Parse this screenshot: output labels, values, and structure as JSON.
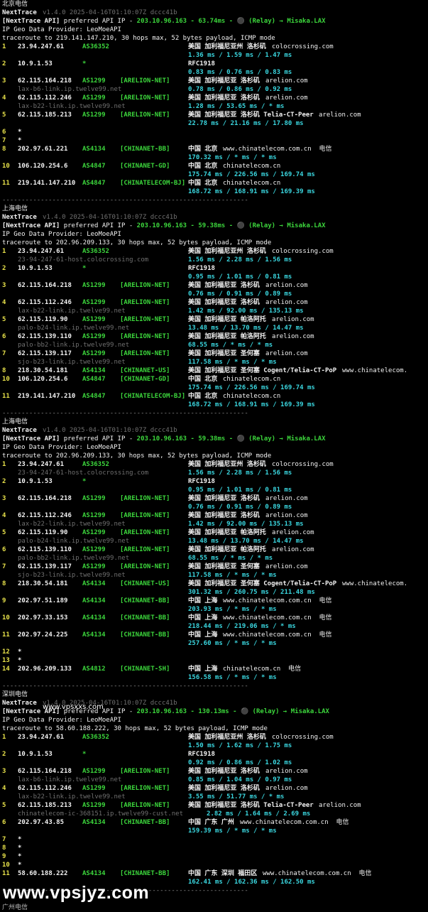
{
  "blocks": [
    {
      "title": "北京电信",
      "app": "NextTrace",
      "version": "v1.4.0 2025-04-16T01:10:07Z dccc41b",
      "api_line": "[NextTrace API] preferred API IP - 203.10.96.163 - 63.74ms - ⚫ (Relay) → Misaka.LAX",
      "geo": "IP Geo Data Provider: LeoMoeAPI",
      "trace": "traceroute to 219.141.147.210, 30 hops max, 52 bytes payload, ICMP mode",
      "hops": [
        {
          "n": "1",
          "ip": "23.94.247.61",
          "as": "AS36352",
          "tag": "",
          "geo": "美国 加利福尼亚州 洛杉矶",
          "host": "colocrossing.com",
          "rdns": "",
          "rtt": "1.36 ms / 1.59 ms / 1.47 ms"
        },
        {
          "n": "2",
          "ip": "10.9.1.53",
          "as": "*",
          "tag": "",
          "geo": "RFC1918",
          "host": "",
          "rdns": "",
          "rtt": "0.83 ms / 0.76 ms / 0.83 ms"
        },
        {
          "n": "3",
          "ip": "62.115.164.218",
          "as": "AS1299",
          "tag": "[ARELION-NET]",
          "geo": "美国 加利福尼亚 洛杉矶",
          "host": "arelion.com",
          "rdns": "lax-b6-link.ip.twelve99.net",
          "rtt": "0.78 ms / 0.86 ms / 0.92 ms"
        },
        {
          "n": "4",
          "ip": "62.115.112.246",
          "as": "AS1299",
          "tag": "[ARELION-NET]",
          "geo": "美国 加利福尼亚 洛杉矶",
          "host": "arelion.com",
          "rdns": "lax-b22-link.ip.twelve99.net",
          "rtt": "1.28 ms / 53.65 ms / * ms"
        },
        {
          "n": "5",
          "ip": "62.115.185.213",
          "as": "AS1299",
          "tag": "[ARELION-NET]",
          "geo": "美国 加利福尼亚 洛杉矶 Telia-CT-Peer",
          "host": "arelion.com",
          "rdns": "",
          "rtt": "22.78 ms / 21.16 ms / 17.80 ms"
        },
        {
          "n": "6",
          "star": true
        },
        {
          "n": "7",
          "star": true
        },
        {
          "n": "8",
          "ip": "202.97.61.221",
          "as": "AS4134",
          "tag": "[CHINANET-BB]",
          "geo": "中国 北京",
          "host": "www.chinatelecom.com.cn  电信",
          "rdns": "",
          "rtt": "170.32 ms / * ms / * ms"
        },
        {
          "n": "10",
          "ip": "106.120.254.6",
          "as": "AS4847",
          "tag": "[CHINANET-GD]",
          "geo": "中国 北京",
          "host": "chinatelecom.cn",
          "rdns": "",
          "rtt": "175.74 ms / 226.56 ms / 169.74 ms"
        },
        {
          "n": "11",
          "ip": "219.141.147.210",
          "as": "AS4847",
          "tag": "[CHINATELECOM-BJ]",
          "geo": "中国 北京",
          "host": "chinatelecom.cn",
          "rdns": "",
          "rtt": "168.72 ms / 168.91 ms / 169.39 ms"
        }
      ]
    },
    {
      "title": "上海电信",
      "app": "NextTrace",
      "version": "v1.4.0 2025-04-16T01:10:07Z dccc41b",
      "api_line": "[NextTrace API] preferred API IP - 203.10.96.163 - 59.38ms - ⚫ (Relay) → Misaka.LAX",
      "geo": "IP Geo Data Provider: LeoMoeAPI",
      "trace": "traceroute to 202.96.209.133, 30 hops max, 52 bytes payload, ICMP mode",
      "hops": [
        {
          "n": "1",
          "ip": "23.94.247.61",
          "as": "AS36352",
          "tag": "",
          "geo": "美国 加利福尼亚州 洛杉矶",
          "host": "colocrossing.com",
          "rdns": "23-94-247-61-host.colocrossing.com",
          "rtt": "1.56 ms / 2.28 ms / 1.56 ms"
        },
        {
          "n": "2",
          "ip": "10.9.1.53",
          "as": "*",
          "tag": "",
          "geo": "RFC1918",
          "host": "",
          "rdns": "",
          "rtt": "0.95 ms / 1.01 ms / 0.81 ms"
        },
        {
          "n": "3",
          "ip": "62.115.164.218",
          "as": "AS1299",
          "tag": "[ARELION-NET]",
          "geo": "美国 加利福尼亚 洛杉矶",
          "host": "arelion.com",
          "rdns": "",
          "rtt": "0.76 ms / 0.91 ms / 0.89 ms"
        },
        {
          "n": "4",
          "ip": "62.115.112.246",
          "as": "AS1299",
          "tag": "[ARELION-NET]",
          "geo": "美国 加利福尼亚 洛杉矶",
          "host": "arelion.com",
          "rdns": "lax-b22-link.ip.twelve99.net",
          "rtt": "1.42 ms / 92.00 ms / 135.13 ms"
        },
        {
          "n": "5",
          "ip": "62.115.119.90",
          "as": "AS1299",
          "tag": "[ARELION-NET]",
          "geo": "美国 加利福尼亚 帕洛阿托",
          "host": "arelion.com",
          "rdns": "palo-b24-link.ip.twelve99.net",
          "rtt": "13.48 ms / 13.70 ms / 14.47 ms"
        },
        {
          "n": "6",
          "ip": "62.115.139.110",
          "as": "AS1299",
          "tag": "[ARELION-NET]",
          "geo": "美国 加利福尼亚 帕洛阿托",
          "host": "arelion.com",
          "rdns": "palo-bb2-link.ip.twelve99.net",
          "rtt": "68.55 ms / * ms / * ms"
        },
        {
          "n": "7",
          "ip": "62.115.139.117",
          "as": "AS1299",
          "tag": "[ARELION-NET]",
          "geo": "美国 加利福尼亚 圣何塞",
          "host": "arelion.com",
          "rdns": "sjo-b23-link.ip.twelve99.net",
          "rtt": "117.58 ms / * ms / * ms"
        },
        {
          "n": "8",
          "ip": "218.30.54.181",
          "as": "AS4134",
          "tag": "[CHINANET-US]",
          "geo": "美国 加利福尼亚 圣何塞 Cogent/Telia-CT-PoP",
          "host": "www.chinatelecom.",
          "rdns": "",
          "rtt": ""
        },
        {
          "n": "10",
          "ip": "106.120.254.6",
          "as": "AS4847",
          "tag": "[CHINANET-GD]",
          "geo": "中国 北京",
          "host": "chinatelecom.cn",
          "rdns": "",
          "rtt": "175.74 ms / 226.56 ms / 169.74 ms",
          "garbled": true
        },
        {
          "n": "11",
          "ip": "219.141.147.210",
          "as": "AS4847",
          "tag": "[CHINATELECOM-BJ]",
          "geo": "中国 北京",
          "host": "chinatelecom.cn",
          "rdns": "",
          "rtt": "168.72 ms / 168.91 ms / 169.39 ms"
        }
      ]
    },
    {
      "title": "上海电信",
      "app": "NextTrace",
      "version": "v1.4.0 2025-04-16T01:10:07Z dccc41b",
      "api_line": "[NextTrace API] preferred API IP - 203.10.96.163 - 59.38ms - ⚫ (Relay) → Misaka.LAX",
      "geo": "IP Geo Data Provider: LeoMoeAPI",
      "trace": "traceroute to 202.96.209.133, 30 hops max, 52 bytes payload, ICMP mode",
      "hops": [
        {
          "n": "1",
          "ip": "23.94.247.61",
          "as": "AS36352",
          "tag": "",
          "geo": "美国 加利福尼亚州 洛杉矶",
          "host": "colocrossing.com",
          "rdns": "23-94-247-61-host.colocrossing.com",
          "rtt": "1.56 ms / 2.28 ms / 1.56 ms"
        },
        {
          "n": "2",
          "ip": "10.9.1.53",
          "as": "*",
          "tag": "",
          "geo": "RFC1918",
          "host": "",
          "rdns": "",
          "rtt": "0.95 ms / 1.01 ms / 0.81 ms"
        },
        {
          "n": "3",
          "ip": "62.115.164.218",
          "as": "AS1299",
          "tag": "[ARELION-NET]",
          "geo": "美国 加利福尼亚 洛杉矶",
          "host": "arelion.com",
          "rdns": "",
          "rtt": "0.76 ms / 0.91 ms / 0.89 ms"
        },
        {
          "n": "4",
          "ip": "62.115.112.246",
          "as": "AS1299",
          "tag": "[ARELION-NET]",
          "geo": "美国 加利福尼亚 洛杉矶",
          "host": "arelion.com",
          "rdns": "lax-b22-link.ip.twelve99.net",
          "rtt": "1.42 ms / 92.00 ms / 135.13 ms"
        },
        {
          "n": "5",
          "ip": "62.115.119.90",
          "as": "AS1299",
          "tag": "[ARELION-NET]",
          "geo": "美国 加利福尼亚 帕洛阿托",
          "host": "arelion.com",
          "rdns": "palo-b24-link.ip.twelve99.net",
          "rtt": "13.48 ms / 13.70 ms / 14.47 ms"
        },
        {
          "n": "6",
          "ip": "62.115.139.110",
          "as": "AS1299",
          "tag": "[ARELION-NET]",
          "geo": "美国 加利福尼亚 帕洛阿托",
          "host": "arelion.com",
          "rdns": "palo-bb2-link.ip.twelve99.net",
          "rtt": "68.55 ms / * ms / * ms"
        },
        {
          "n": "7",
          "ip": "62.115.139.117",
          "as": "AS1299",
          "tag": "[ARELION-NET]",
          "geo": "美国 加利福尼亚 圣何塞",
          "host": "arelion.com",
          "rdns": "sjo-b23-link.ip.twelve99.net",
          "rtt": "117.58 ms / * ms / * ms"
        },
        {
          "n": "8",
          "ip": "218.30.54.181",
          "as": "AS4134",
          "tag": "[CHINANET-US]",
          "geo": "美国 加利福尼亚 圣何塞 Cogent/Telia-CT-PoP",
          "host": "www.chinatelecom.",
          "rdns": "",
          "rtt": "301.32 ms / 260.75 ms / 211.48 ms"
        },
        {
          "n": "9",
          "ip": "202.97.51.189",
          "as": "AS4134",
          "tag": "[CHINANET-BB]",
          "geo": "中国 上海",
          "host": "www.chinatelecom.com.cn  电信",
          "rdns": "",
          "rtt": "203.93 ms / * ms / * ms"
        },
        {
          "n": "10",
          "ip": "202.97.33.153",
          "as": "AS4134",
          "tag": "[CHINANET-BB]",
          "geo": "中国 上海",
          "host": "www.chinatelecom.com.cn  电信",
          "rdns": "",
          "rtt": "218.44 ms / 219.06 ms / * ms"
        },
        {
          "n": "11",
          "ip": "202.97.24.225",
          "as": "AS4134",
          "tag": "[CHINANET-BB]",
          "geo": "中国 上海",
          "host": "www.chinatelecom.com.cn  电信",
          "rdns": "",
          "rtt": "257.60 ms / * ms / * ms"
        },
        {
          "n": "12",
          "star": true
        },
        {
          "n": "13",
          "star": true
        },
        {
          "n": "14",
          "ip": "202.96.209.133",
          "as": "AS4812",
          "tag": "[CHINANET-SH]",
          "geo": "中国 上海",
          "host": "chinatelecom.cn  电信",
          "rdns": "",
          "rtt": "156.58 ms / * ms / * ms"
        }
      ]
    },
    {
      "title": "深圳电信",
      "app": "NextTrace",
      "version": "v1.4.0 2025-04-16T01:10:07Z dccc41b",
      "api_line": "[NextTrace API] preferred API IP - 203.10.96.163 - 130.13ms - ⚫ (Relay) → Misaka.LAX",
      "geo": "IP Geo Data Provider: LeoMoeAPI",
      "trace": "traceroute to 58.60.188.222, 30 hops max, 52 bytes payload, ICMP mode",
      "hops": [
        {
          "n": "1",
          "ip": "23.94.247.61",
          "as": "AS36352",
          "tag": "",
          "geo": "美国 加利福尼亚州 洛杉矶",
          "host": "colocrossing.com",
          "rdns": "",
          "rtt": "1.50 ms / 1.62 ms / 1.75 ms"
        },
        {
          "n": "2",
          "ip": "10.9.1.53",
          "as": "*",
          "tag": "",
          "geo": "RFC1918",
          "host": "",
          "rdns": "",
          "rtt": "0.92 ms / 0.86 ms / 1.02 ms"
        },
        {
          "n": "3",
          "ip": "62.115.164.218",
          "as": "AS1299",
          "tag": "[ARELION-NET]",
          "geo": "美国 加利福尼亚 洛杉矶",
          "host": "arelion.com",
          "rdns": "lax-b6-link.ip.twelve99.net",
          "rtt": "0.85 ms / 1.04 ms / 0.97 ms"
        },
        {
          "n": "4",
          "ip": "62.115.112.246",
          "as": "AS1299",
          "tag": "[ARELION-NET]",
          "geo": "美国 加利福尼亚 洛杉矶",
          "host": "arelion.com",
          "rdns": "lax-b22-link.ip.twelve99.net",
          "rtt": "3.55 ms / 51.77 ms / * ms"
        },
        {
          "n": "5",
          "ip": "62.115.185.213",
          "as": "AS1299",
          "tag": "[ARELION-NET]",
          "geo": "美国 加利福尼亚 洛杉矶 Telia-CT-Peer",
          "host": "arelion.com",
          "rdns": "chinatelecom-ic-368151.ip.twelve99-cust.net",
          "rtt": "2.82 ms / 1.64 ms / 2.69 ms",
          "rdns_inline": true
        },
        {
          "n": "6",
          "ip": "202.97.43.85",
          "as": "AS4134",
          "tag": "[CHINANET-BB]",
          "geo": "中国 广东 广州",
          "host": "www.chinatelecom.com.cn  电信",
          "rdns": "",
          "rtt": "159.39 ms / * ms / * ms"
        },
        {
          "n": "7",
          "star": true
        },
        {
          "n": "8",
          "star": true
        },
        {
          "n": "9",
          "star": true
        },
        {
          "n": "10",
          "star": true
        },
        {
          "n": "11",
          "ip": "58.60.188.222",
          "as": "AS4134",
          "tag": "[CHINANET-BB]",
          "geo": "中国 广东 深圳 福田区",
          "host": "www.chinatelecom.com.cn  电信",
          "rdns": "",
          "rtt": "162.41 ms / 162.36 ms / 162.50 ms"
        }
      ]
    }
  ],
  "separator": "----------------------------------------------------------------",
  "watermark_small": "www.vpsxxs.com",
  "watermark_big": "www.vpsjyz.com",
  "bottom_cut": "广州电信"
}
